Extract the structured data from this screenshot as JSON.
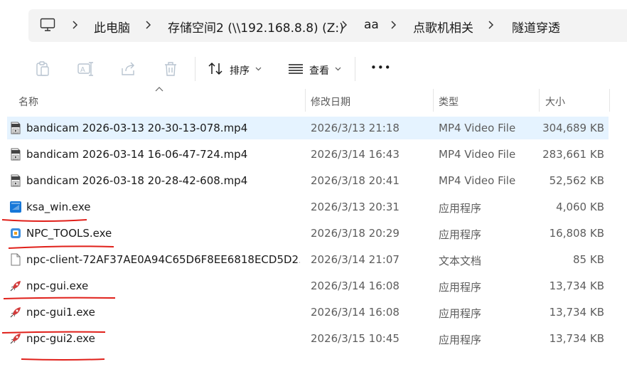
{
  "breadcrumb": {
    "items": [
      "此电脑",
      "存储空间2 (\\\\192.168.8.8) (Z:)",
      "aa",
      "点歌机相关",
      "隧道穿透"
    ]
  },
  "toolbar": {
    "sort_label": "排序",
    "view_label": "查看",
    "more_label": "•••"
  },
  "columns": {
    "name": "名称",
    "date": "修改日期",
    "type": "类型",
    "size": "大小"
  },
  "files": [
    {
      "name": "bandicam 2026-03-13 20-30-13-078.mp4",
      "date": "2026/3/13 21:18",
      "type": "MP4 Video File",
      "size": "304,689 KB",
      "icon": "video-file-icon",
      "selected": true
    },
    {
      "name": "bandicam 2026-03-14 16-06-47-724.mp4",
      "date": "2026/3/14 16:43",
      "type": "MP4 Video File",
      "size": "283,661 KB",
      "icon": "video-file-icon"
    },
    {
      "name": "bandicam 2026-03-18 20-28-42-608.mp4",
      "date": "2026/3/18 20:41",
      "type": "MP4 Video File",
      "size": "52,562 KB",
      "icon": "video-file-icon"
    },
    {
      "name": "ksa_win.exe",
      "date": "2026/3/13 20:31",
      "type": "应用程序",
      "size": "4,060 KB",
      "icon": "ksa-app-icon"
    },
    {
      "name": "NPC_TOOLS.exe",
      "date": "2026/3/18 20:29",
      "type": "应用程序",
      "size": "16,808 KB",
      "icon": "npc-tools-app-icon"
    },
    {
      "name": "npc-client-72AF37AE0A94C65D6F8EE6818ECD5D2...",
      "date": "2026/3/14 21:07",
      "type": "文本文档",
      "size": "85 KB",
      "icon": "text-file-icon"
    },
    {
      "name": "npc-gui.exe",
      "date": "2026/3/14 16:08",
      "type": "应用程序",
      "size": "13,734 KB",
      "icon": "rocket-app-icon"
    },
    {
      "name": "npc-gui1.exe",
      "date": "2026/3/14 16:08",
      "type": "应用程序",
      "size": "13,734 KB",
      "icon": "rocket-app-icon"
    },
    {
      "name": "npc-gui2.exe",
      "date": "2026/3/15 10:45",
      "type": "应用程序",
      "size": "13,734 KB",
      "icon": "rocket-app-icon"
    }
  ],
  "colors": {
    "selection": "#e5f3ff",
    "annotation": "#e0201a",
    "toolbar_disabled": "#b8c4d0"
  }
}
